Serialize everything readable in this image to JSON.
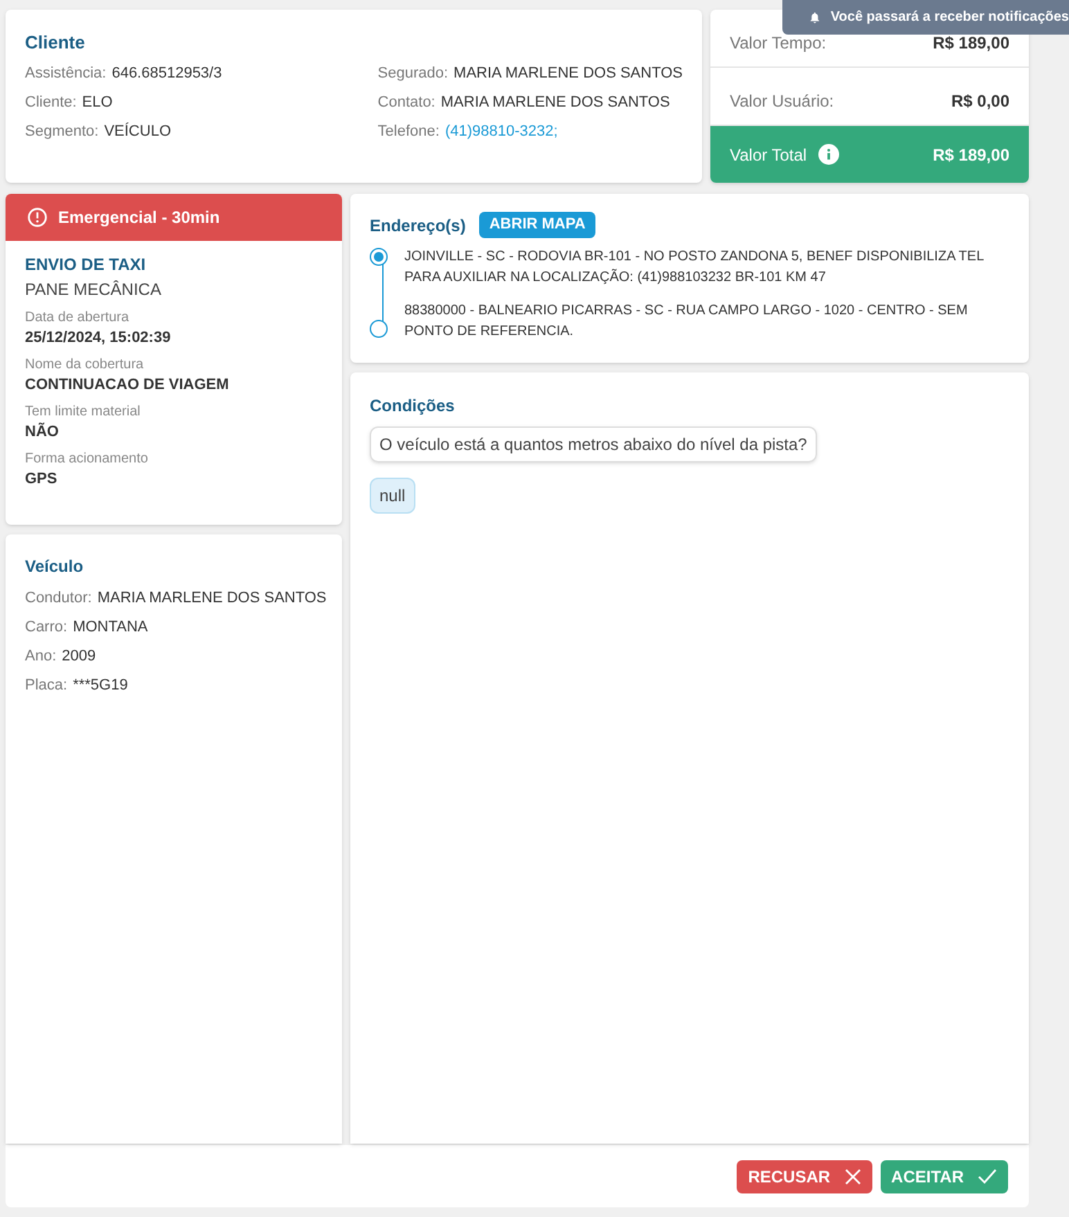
{
  "notification": {
    "text": "Você passará a receber notificações"
  },
  "client": {
    "title": "Cliente",
    "left": [
      {
        "label": "Assistência:",
        "value": "646.68512953/3",
        "kind": "text"
      },
      {
        "label": "Cliente:",
        "value": "ELO",
        "kind": "text"
      },
      {
        "label": "Segmento:",
        "value": "VEÍCULO",
        "kind": "text"
      }
    ],
    "right": [
      {
        "label": "Segurado:",
        "value": "MARIA MARLENE DOS SANTOS",
        "kind": "text"
      },
      {
        "label": "Contato:",
        "value": "MARIA MARLENE DOS SANTOS",
        "kind": "text"
      },
      {
        "label": "Telefone:",
        "value": "(41)98810-3232;",
        "kind": "link"
      }
    ]
  },
  "values": {
    "rows": [
      {
        "label": "Valor Tempo:",
        "value": "R$ 189,00"
      },
      {
        "label": "Valor Usuário:",
        "value": "R$ 0,00"
      }
    ],
    "total": {
      "label": "Valor Total",
      "value": "R$ 189,00"
    }
  },
  "service": {
    "priority": "Emergencial - 30min",
    "title": "ENVIO DE TAXI",
    "subtitle": "PANE MECÂNICA",
    "fields": [
      {
        "label": "Data de abertura",
        "value": "25/12/2024, 15:02:39"
      },
      {
        "label": "Nome da cobertura",
        "value": "CONTINUACAO DE VIAGEM"
      },
      {
        "label": "Tem limite material",
        "value": "NÃO"
      },
      {
        "label": "Forma acionamento",
        "value": "GPS"
      }
    ]
  },
  "vehicle": {
    "title": "Veículo",
    "rows": [
      {
        "label": "Condutor:",
        "value": "MARIA MARLENE DOS SANTOS",
        "kind": "text"
      },
      {
        "label": "Carro:",
        "value": "MONTANA",
        "kind": "text"
      },
      {
        "label": "Ano:",
        "value": "2009",
        "kind": "text"
      },
      {
        "label": "Placa:",
        "value": "***5G19",
        "kind": "text"
      }
    ]
  },
  "addresses": {
    "title": "Endereço(s)",
    "button": "ABRIR MAPA",
    "items": [
      {
        "text": "JOINVILLE - SC - RODOVIA BR-101 - NO POSTO ZANDONA 5, BENEF DISPONIBILIZA TEL PARA AUXILIAR NA LOCALIZAÇÃO: (41)988103232 BR-101 KM 47",
        "selected": true
      },
      {
        "text": "88380000 - BALNEARIO PICARRAS - SC - RUA CAMPO LARGO - 1020 - CENTRO - SEM PONTO DE REFERENCIA.",
        "selected": false
      }
    ]
  },
  "conditions": {
    "title": "Condições",
    "question": "O veículo está a quantos metros abaixo do nível da pista?",
    "answer": "null"
  },
  "actions": [
    {
      "label": "RECUSAR",
      "kind": "reject"
    },
    {
      "label": "ACEITAR",
      "kind": "accept"
    }
  ]
}
